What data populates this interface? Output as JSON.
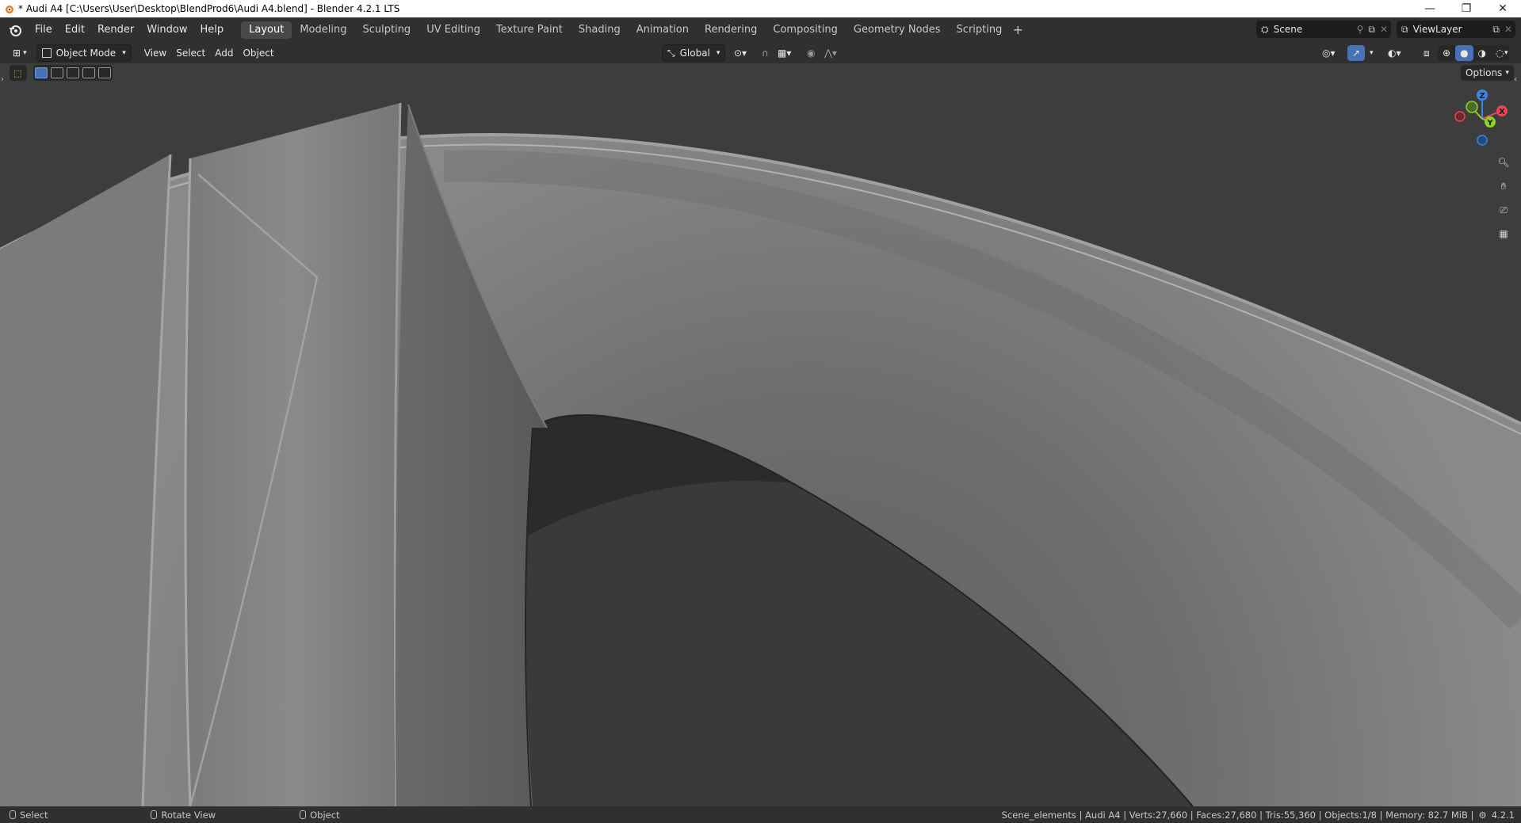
{
  "window": {
    "title": "* Audi A4 [C:\\Users\\User\\Desktop\\BlendProd6\\Audi A4.blend] - Blender 4.2.1 LTS",
    "minimize": "—",
    "restore": "❐",
    "close": "✕"
  },
  "menu": {
    "items": [
      "File",
      "Edit",
      "Render",
      "Window",
      "Help"
    ]
  },
  "workspaces": {
    "tabs": [
      "Layout",
      "Modeling",
      "Sculpting",
      "UV Editing",
      "Texture Paint",
      "Shading",
      "Animation",
      "Rendering",
      "Compositing",
      "Geometry Nodes",
      "Scripting"
    ],
    "active": "Layout",
    "add": "+"
  },
  "scene": {
    "label": "Scene"
  },
  "view_layer": {
    "label": "ViewLayer"
  },
  "header": {
    "mode": "Object Mode",
    "menus": [
      "View",
      "Select",
      "Add",
      "Object"
    ],
    "orientation": "Global",
    "options": "Options"
  },
  "gizmo": {
    "x": "X",
    "y": "Y",
    "z": "Z"
  },
  "status": {
    "select": "Select",
    "rotate": "Rotate View",
    "object": "Object",
    "info": "Scene_elements | Audi A4 | Verts:27,660 | Faces:27,680 | Tris:55,360 | Objects:1/8 | Memory: 82.7 MiB |",
    "version": "4.2.1"
  },
  "colors": {
    "accent": "#4772b3",
    "x_axis": "#e84652",
    "y_axis": "#8bd32c",
    "z_axis": "#3f84e2"
  }
}
